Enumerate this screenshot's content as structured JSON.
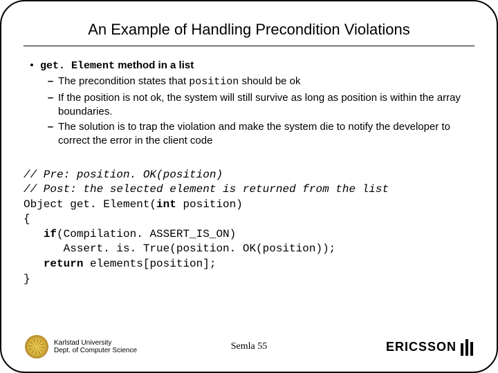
{
  "title": "An Example of Handling Precondition Violations",
  "b1_prefix": "get. Element",
  "b1_suffix": " method in a list",
  "s1a": "The precondition states that ",
  "s1b": "position",
  "s1c": " should be ok",
  "s2": "If the position is not ok, the system will still survive as long as position is within the array boundaries.",
  "s3": "The solution is to trap the violation and make the system die to notify the developer to correct the error in the client code",
  "code": {
    "c1": "// Pre: position. OK(position)",
    "c2": "// Post: the selected element is returned from the list",
    "l3a": "Object get. Element(",
    "l3b": "int",
    "l3c": " position)",
    "l4": "{",
    "l5a": "   ",
    "l5b": "if",
    "l5c": "(Compilation. ASSERT_IS_ON)",
    "l6": "      Assert. is. True(position. OK(position));",
    "l7a": "   ",
    "l7b": "return",
    "l7c": " elements[position];",
    "l8": "}"
  },
  "footer": {
    "uni1": "Karlstad University",
    "uni2": "Dept. of Computer Science",
    "page": "Semla 55",
    "brand": "ERICSSON"
  }
}
